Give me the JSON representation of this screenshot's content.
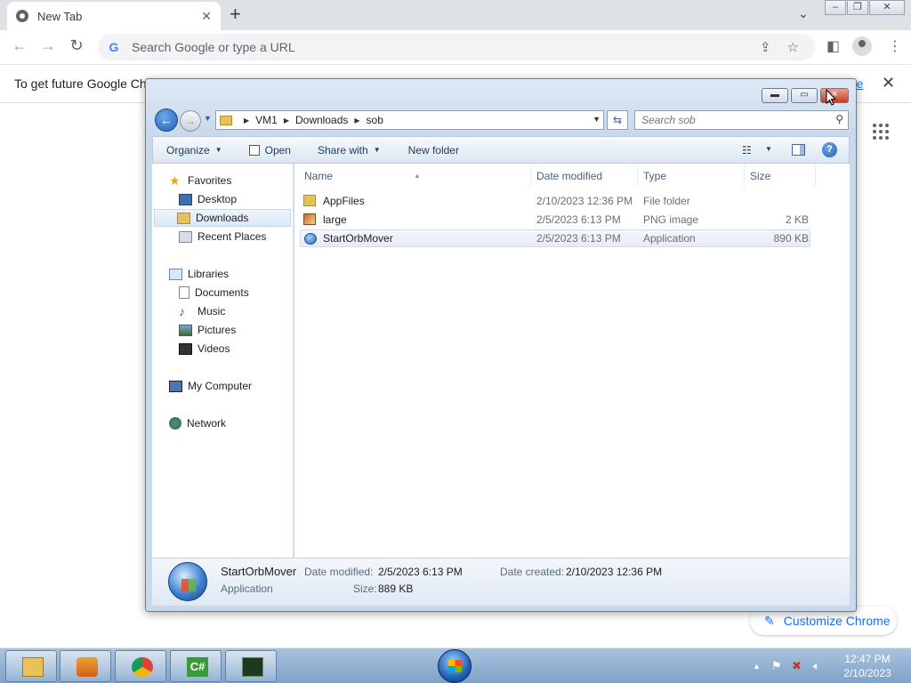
{
  "chrome": {
    "tab_title": "New Tab",
    "tab_close": "✕",
    "new_tab": "+",
    "omnibox_placeholder": "Search Google or type a URL",
    "info_text": "To get future Google Chro",
    "info_link": "re",
    "info_close": "✕",
    "customize_label": "Customize Chrome",
    "icons": [
      "chrome-favicon",
      "back-arrow-icon",
      "forward-arrow-icon",
      "reload-icon",
      "google-g-icon",
      "share-icon",
      "star-icon",
      "side-panel-icon",
      "profile-icon",
      "kebab-menu-icon",
      "apps-grid-icon",
      "pencil-icon"
    ]
  },
  "explorer": {
    "breadcrumbs": [
      "VM1",
      "Downloads",
      "sob"
    ],
    "search_placeholder": "Search sob",
    "commands": {
      "organize": "Organize",
      "open": "Open",
      "share_with": "Share with",
      "new_folder": "New folder"
    },
    "nav": {
      "favorites": "Favorites",
      "desktop": "Desktop",
      "downloads": "Downloads",
      "recent": "Recent Places",
      "libraries": "Libraries",
      "documents": "Documents",
      "music": "Music",
      "pictures": "Pictures",
      "videos": "Videos",
      "computer": "My Computer",
      "network": "Network"
    },
    "columns": {
      "name": "Name",
      "date": "Date modified",
      "type": "Type",
      "size": "Size"
    },
    "files": [
      {
        "name": "AppFiles",
        "date": "2/10/2023 12:36 PM",
        "type": "File folder",
        "size": ""
      },
      {
        "name": "large",
        "date": "2/5/2023 6:13 PM",
        "type": "PNG image",
        "size": "2 KB"
      },
      {
        "name": "StartOrbMover",
        "date": "2/5/2023 6:13 PM",
        "type": "Application",
        "size": "890 KB"
      }
    ],
    "selected_file": "StartOrbMover",
    "details": {
      "name": "StartOrbMover",
      "kind": "Application",
      "date_modified_label": "Date modified:",
      "date_modified": "2/5/2023 6:13 PM",
      "size_label": "Size:",
      "size": "889 KB",
      "date_created_label": "Date created:",
      "date_created": "2/10/2023 12:36 PM"
    }
  },
  "taskbar": {
    "apps": [
      "windows-explorer",
      "media-player",
      "google-chrome",
      "csharp-editor",
      "command-prompt"
    ],
    "time": "12:47 PM",
    "date": "2/10/2023"
  }
}
